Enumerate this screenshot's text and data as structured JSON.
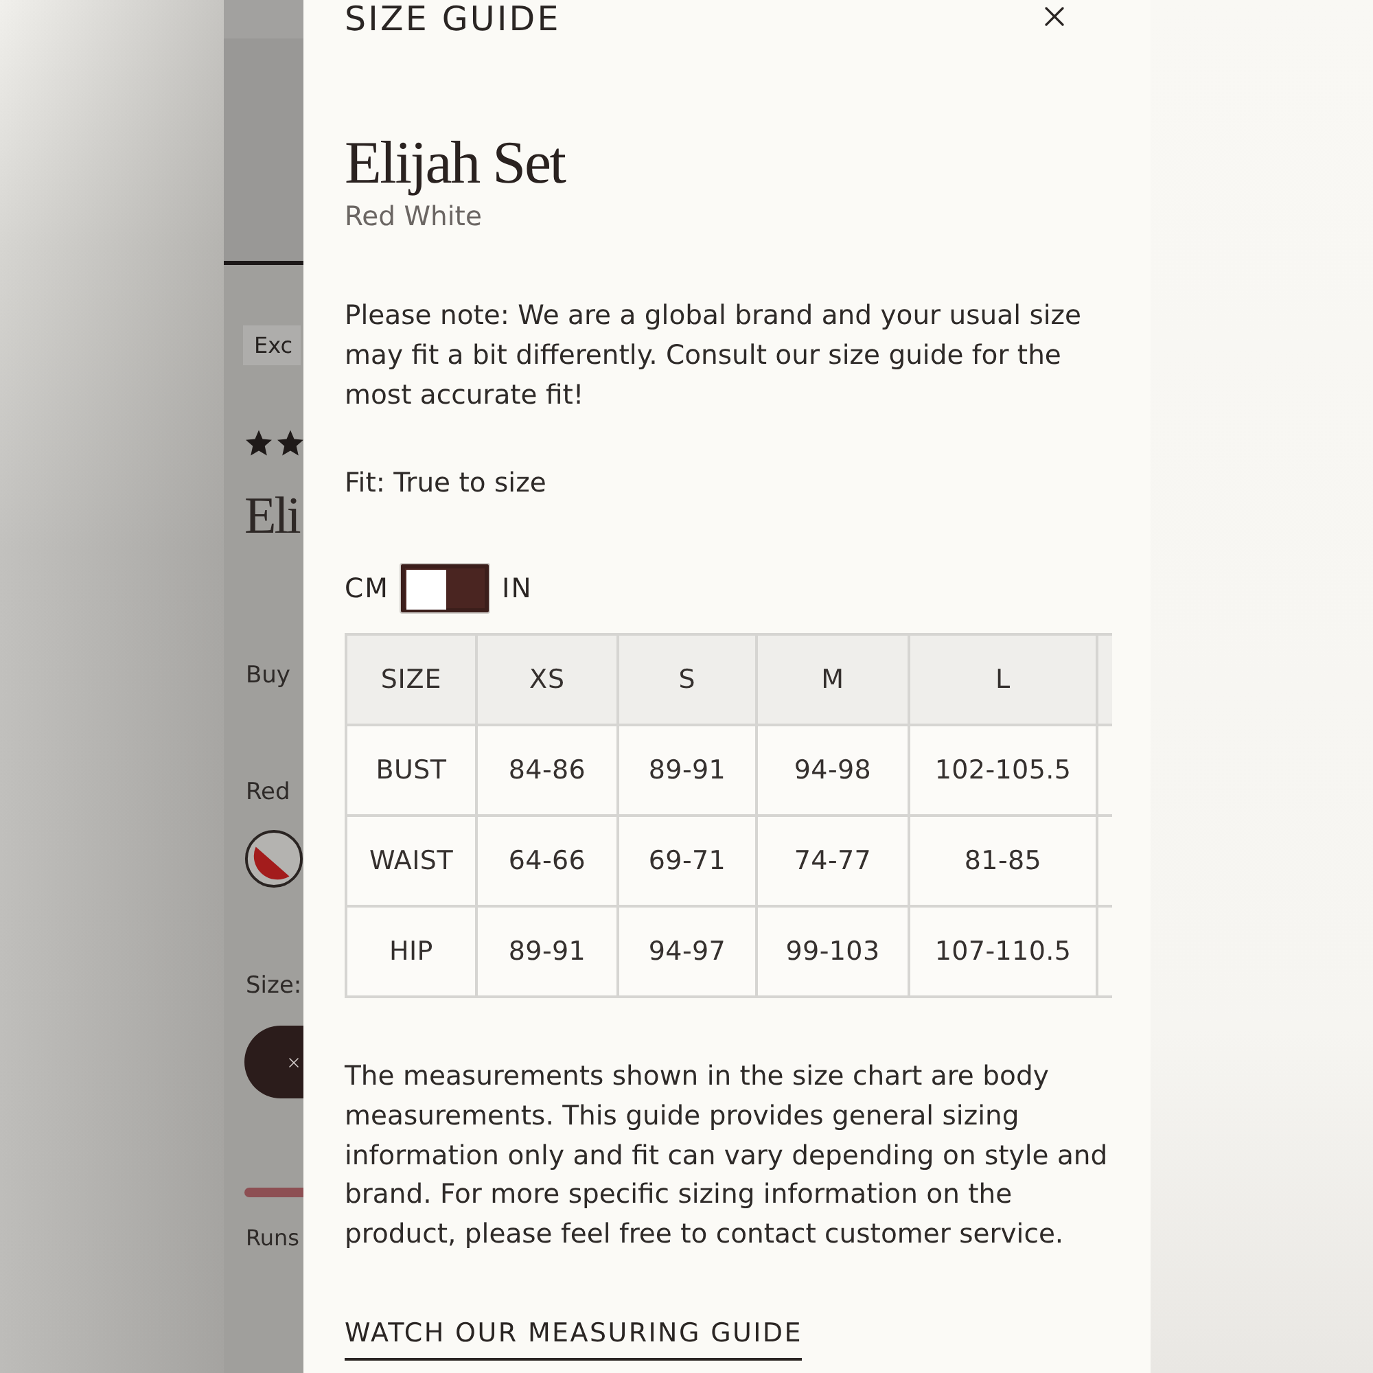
{
  "background_page": {
    "badge": "Exc",
    "title": "Eli",
    "buy_label": "Buy",
    "color_label": "Red",
    "size_label": "Size:",
    "fit_label": "Runs"
  },
  "modal": {
    "heading": "SIZE GUIDE",
    "product_name": "Elijah Set",
    "color_name": "Red White",
    "note": "Please note: We are a global brand and your usual size may fit a bit differently. Consult our size guide for the most accurate fit!",
    "fit": "Fit: True to size",
    "unit_switch": {
      "left_label": "CM",
      "right_label": "IN",
      "on": false
    },
    "size_table": {
      "columns": [
        "SIZE",
        "XS",
        "S",
        "M",
        "L"
      ],
      "rows": [
        {
          "label": "BUST",
          "values": [
            "84-86",
            "89-91",
            "94-98",
            "102-105.5"
          ]
        },
        {
          "label": "WAIST",
          "values": [
            "64-66",
            "69-71",
            "74-77",
            "81-85"
          ]
        },
        {
          "label": "HIP",
          "values": [
            "89-91",
            "94-97",
            "99-103",
            "107-110.5"
          ]
        }
      ]
    },
    "disclaimer": "The measurements shown in the size chart are body measurements. This guide provides general sizing information only and fit can vary depending on style and brand. For more specific sizing information on the product, please feel free to contact customer service.",
    "link": "WATCH OUR MEASURING GUIDE"
  }
}
